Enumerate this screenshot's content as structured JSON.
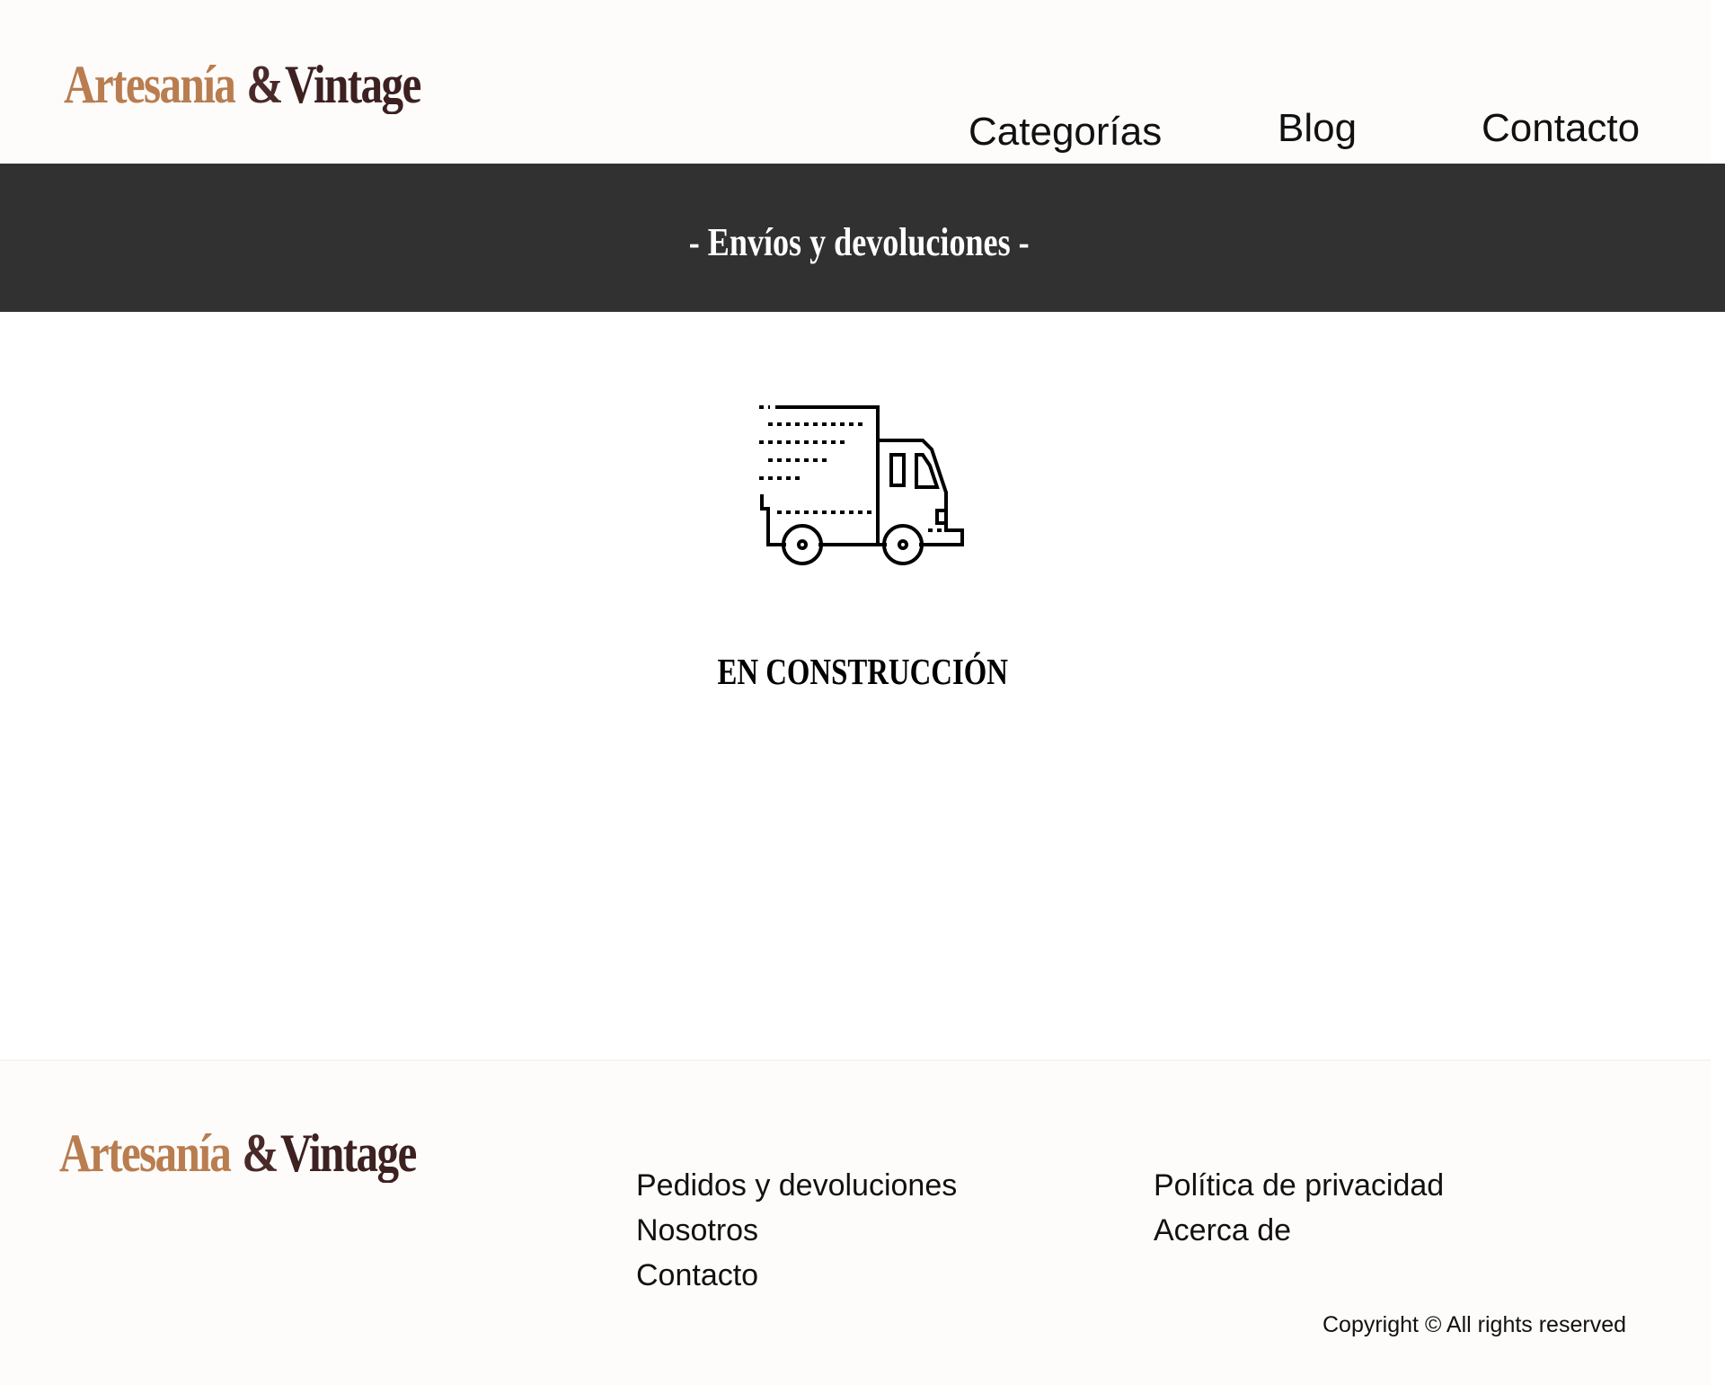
{
  "brand": {
    "name_part1": "Artesanía",
    "ampersand": "&",
    "name_part2": "Vintage",
    "colors": {
      "part1": "#b97d4f",
      "ampersand": "#4a2929",
      "part2": "#3d2020"
    }
  },
  "nav": {
    "items": [
      {
        "label": "Categorías"
      },
      {
        "label": "Blog"
      },
      {
        "label": "Contacto"
      }
    ]
  },
  "banner": {
    "title": "- Envíos y devoluciones -",
    "background": "#313131"
  },
  "main": {
    "icon": "delivery-truck-icon",
    "status": "EN CONSTRUCCIÓN"
  },
  "footer": {
    "links_col1": [
      {
        "label": "Pedidos y devoluciones"
      },
      {
        "label": "Nosotros"
      },
      {
        "label": "Contacto"
      }
    ],
    "links_col2": [
      {
        "label": "Política de privacidad"
      },
      {
        "label": "Acerca de"
      }
    ],
    "copyright": "Copyright © All rights reserved"
  }
}
